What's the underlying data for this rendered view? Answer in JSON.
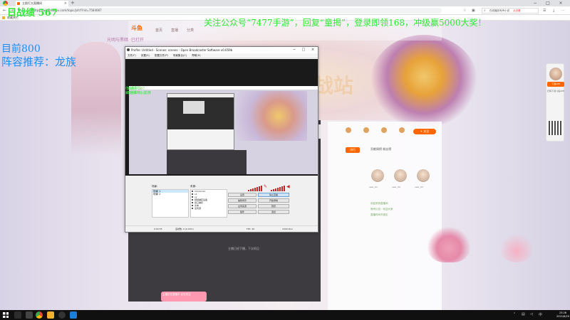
{
  "browser": {
    "tab_title": "立即打大直播间",
    "url": "https://www.douyu.com/topic/jsfcf?rid=7584087",
    "search_placeholder": "在线播放有声小说",
    "search_hot": "点击看",
    "bookmark": "收藏夹栏",
    "new_tab": "+",
    "minimize": "−",
    "maximize": "□",
    "close": "×"
  },
  "overlay": {
    "top_left": "日战绩 567",
    "top_right": "关注公众号“7477手游”，回复“童揭”，登录即领168，冲级赢5000大奖！",
    "line1": "目前800",
    "line2": "阵容推荐：龙族",
    "small1": "日战绩 567",
    "small2": "阵容推荐：龙族"
  },
  "site": {
    "logo": "斗鱼",
    "top_text": "光明与黑暗 ·已打开",
    "nav": [
      "首页",
      "直播",
      "分类"
    ],
    "hero_title": "战站",
    "follow": "+ 关注",
    "rank_tab": "排行",
    "side_tabs": "贡献周榜  粉丝榜",
    "avatar_names": [
      "user_01",
      "user_02",
      "user_03"
    ],
    "side_rows": [
      "欢迎来到直播间",
      "房间公告：欢迎大家",
      "直播时间不固定"
    ],
    "player_footer": "主播已经下播，下次再见",
    "gift_popup": "主播正在直播中 点击关注",
    "qr_caption": "扫码下载斗鱼APP",
    "qr_label": "下载APP"
  },
  "obs": {
    "title": "Profile: Untitled - Scenes: scenes - Open Broadcaster Software v0.659b",
    "menu": [
      "文件(F)",
      "设置(S)",
      "配置文件(P)",
      "场景集合(C)",
      "帮助(H)"
    ],
    "scenes_label": "场景：",
    "sources_label": "来源：",
    "scenes": [
      "场景 1",
      "场景 2"
    ],
    "sources": [
      "11111111",
      "v1",
      "yy",
      "视频捕获设备",
      "窗口捕获",
      "文本",
      "全局源"
    ],
    "buttons": {
      "settings": "设置",
      "start_stream": "停止直播",
      "edit_scene": "编辑场景",
      "start_record": "开始录制",
      "global_sources": "全局来源",
      "preview": "预览",
      "plugins": "插件",
      "exit": "退出"
    },
    "status": {
      "time": "0:00:55",
      "dropped": "丢帧数: 0 (0.00%)",
      "fps": "FPS: 30",
      "bitrate": "2400 kb/s"
    }
  },
  "taskbar": {
    "time": "23:26",
    "date": "2021/8/29"
  },
  "colors": {
    "overlay_green": "#34e63a",
    "overlay_blue": "#1f8ef3",
    "brand_orange": "#ff6600"
  }
}
